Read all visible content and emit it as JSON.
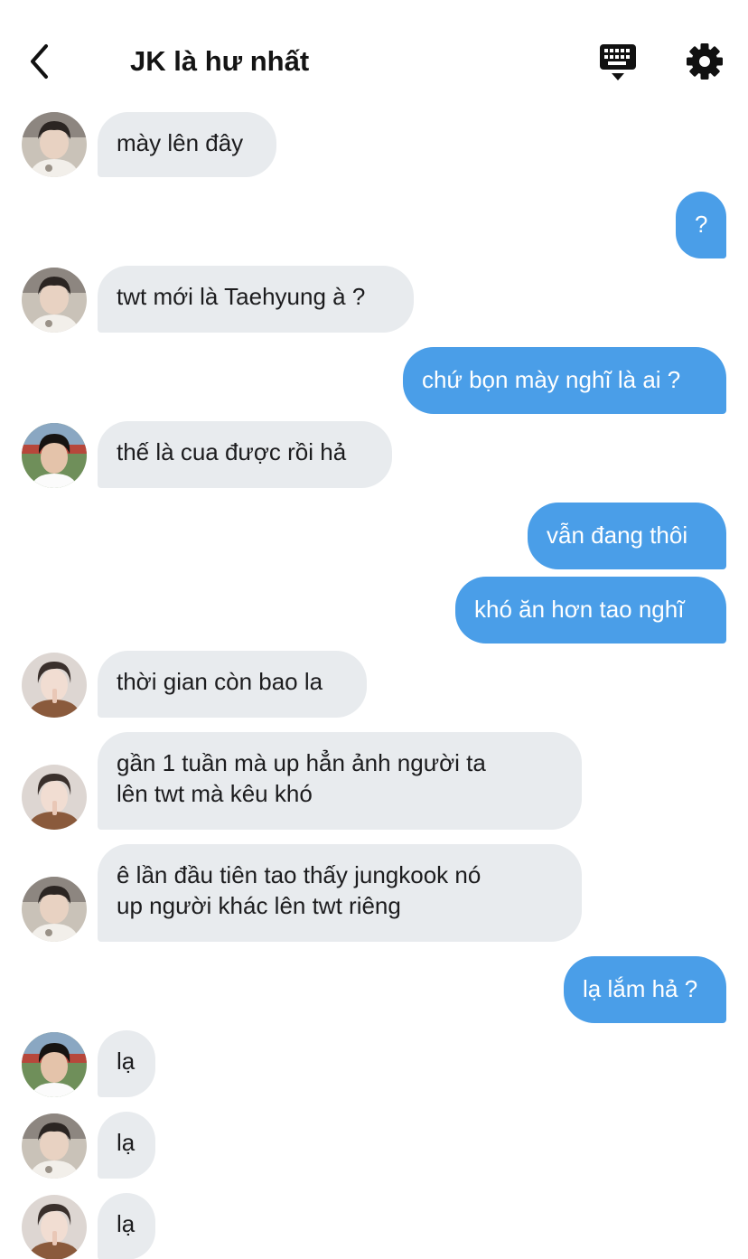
{
  "header": {
    "title": "JK là hư nhất",
    "back_icon": "chevron-left-icon",
    "keyboard_icon": "keyboard-icon",
    "settings_icon": "gear-icon"
  },
  "colors": {
    "outgoing_bubble": "#4a9ee8",
    "incoming_bubble": "#e8ebee",
    "text_dark": "#1c1c1e",
    "text_light": "#ffffff"
  },
  "messages": [
    {
      "dir": "in",
      "avatar": "a",
      "text": "mày lên đây"
    },
    {
      "dir": "out",
      "text": "?"
    },
    {
      "dir": "in",
      "avatar": "a",
      "text": "twt mới là Taehyung à ?"
    },
    {
      "dir": "out",
      "text": "chứ bọn mày nghĩ là ai ?"
    },
    {
      "dir": "in",
      "avatar": "b",
      "text": "thế là cua được rồi hả"
    },
    {
      "dir": "out",
      "text": "vẫn đang thôi"
    },
    {
      "dir": "out",
      "text": "khó ăn hơn tao nghĩ"
    },
    {
      "dir": "in",
      "avatar": "c",
      "text": "thời gian còn bao la"
    },
    {
      "dir": "in",
      "avatar": "c",
      "text": "gần 1 tuần mà up hẳn ảnh người ta\nlên twt mà kêu khó"
    },
    {
      "dir": "in",
      "avatar": "a",
      "text": "ê lần đầu tiên tao thấy jungkook nó\nup người khác lên twt riêng"
    },
    {
      "dir": "out",
      "text": "lạ lắm hả ?"
    },
    {
      "dir": "in",
      "avatar": "b",
      "text": "lạ"
    },
    {
      "dir": "in",
      "avatar": "a",
      "text": "lạ"
    },
    {
      "dir": "in",
      "avatar": "c",
      "text": "lạ"
    }
  ]
}
